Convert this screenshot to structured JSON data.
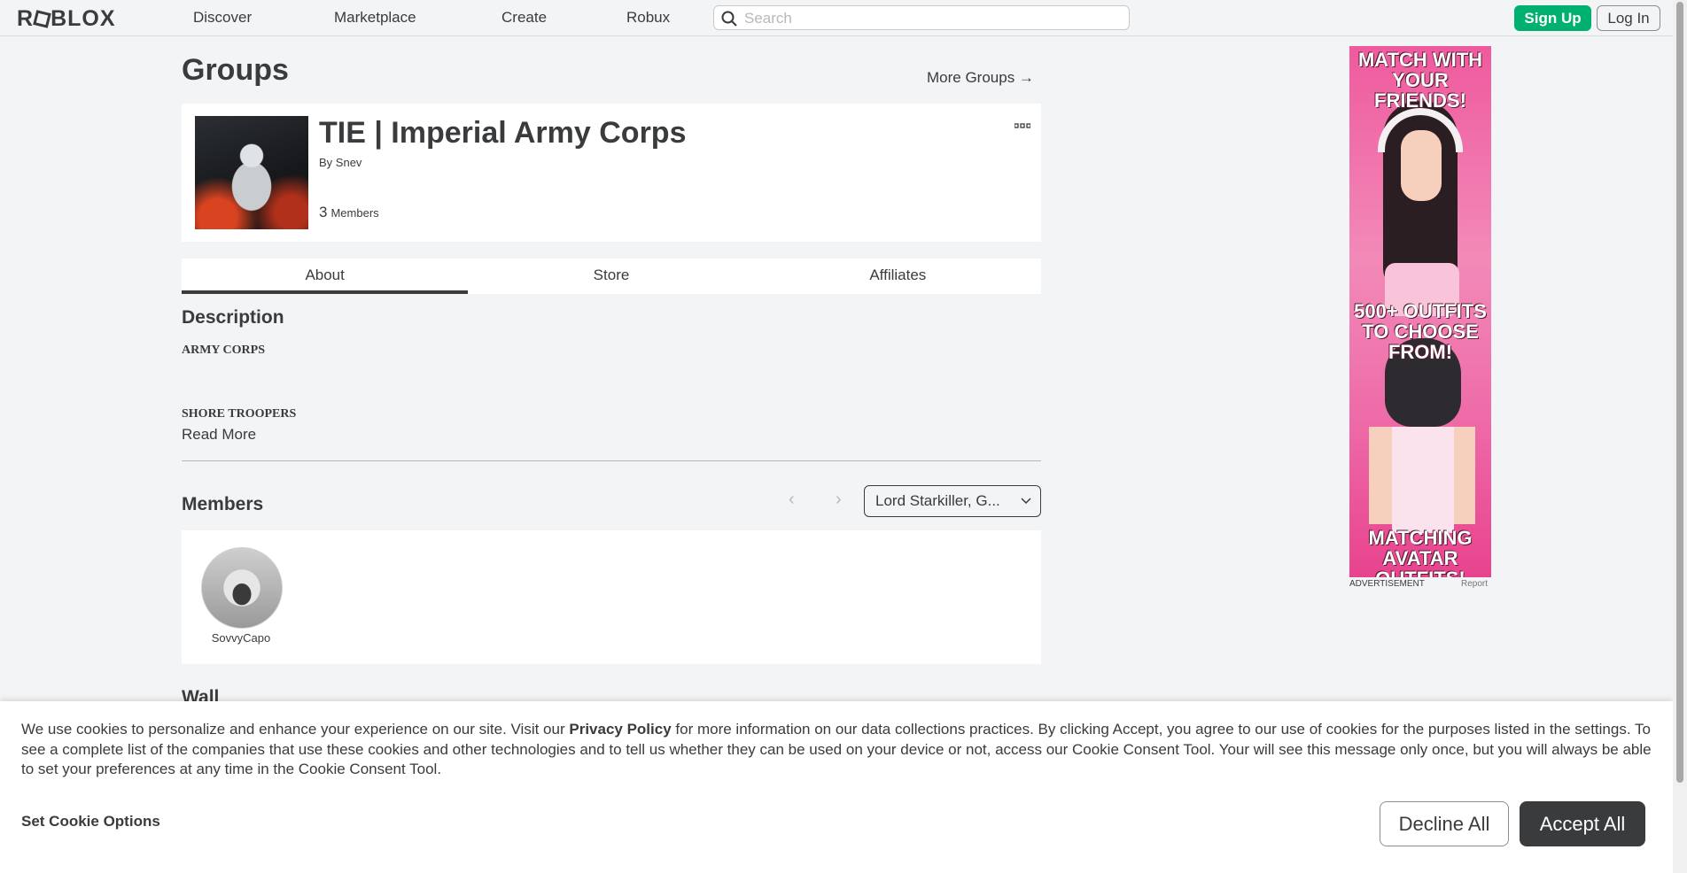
{
  "brand": {
    "logo_text": "ROBLOX"
  },
  "nav": {
    "links": [
      "Discover",
      "Marketplace",
      "Create",
      "Robux"
    ],
    "search_placeholder": "Search",
    "signup_label": "Sign Up",
    "login_label": "Log In"
  },
  "page": {
    "title": "Groups",
    "more_groups": "More Groups →"
  },
  "group": {
    "name": "TIE | Imperial Army Corps",
    "by_label": "By",
    "owner": "Snev",
    "member_count": "3",
    "member_label": "Members",
    "menu_icon": "ellipsis-icon"
  },
  "tabs": [
    "About",
    "Store",
    "Affiliates"
  ],
  "about": {
    "description_title": "Description",
    "description_lines": [
      "ARMY CORPS",
      "SHORE TROOPERS"
    ],
    "read_more": "Read More"
  },
  "members": {
    "title": "Members",
    "role_selected": "Lord Starkiller, G...",
    "list": [
      {
        "name": "SovvyCapo"
      }
    ]
  },
  "wall": {
    "title": "Wall"
  },
  "ad": {
    "headline_top": "MATCH WITH YOUR FRIENDS!",
    "headline_mid": "500+ OUTFITS TO CHOOSE FROM!",
    "headline_bottom": "MATCHING AVATAR OUTFITS!",
    "label": "ADVERTISEMENT",
    "report": "Report"
  },
  "cookie": {
    "text_before": "We use cookies to personalize and enhance your experience on our site. Visit our ",
    "privacy_link": "Privacy Policy",
    "text_after": " for more information on our data collections practices. By clicking Accept, you agree to our use of cookies for the purposes listed in the settings. To see a complete list of the companies that use these cookies and other technologies and to tell us whether they can be used on your device or not, access our Cookie Consent Tool. Your will see this message only once, but you will always be able to set your preferences at any time in the Cookie Consent Tool.",
    "options_label": "Set Cookie Options",
    "decline_label": "Decline All",
    "accept_label": "Accept All"
  },
  "colors": {
    "accent_green": "#00b06f",
    "text": "#393b3d",
    "background": "#f2f4f5"
  }
}
